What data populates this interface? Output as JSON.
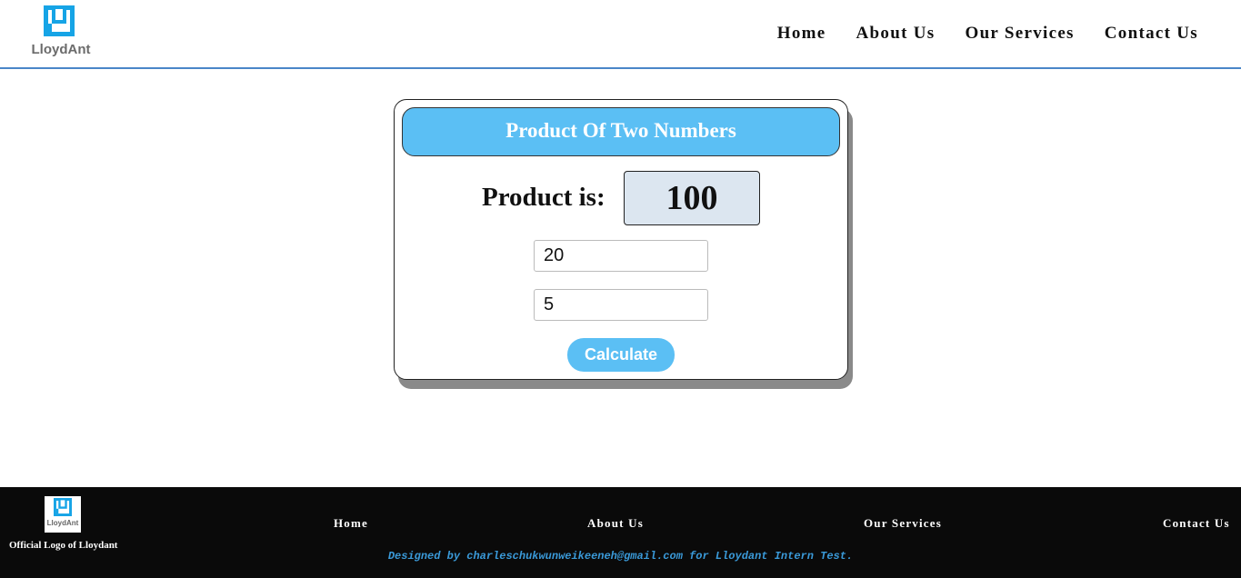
{
  "header": {
    "logo_text": "LloydAnt",
    "nav": [
      {
        "label": "Home"
      },
      {
        "label": "About Us"
      },
      {
        "label": "Our Services"
      },
      {
        "label": "Contact Us"
      }
    ]
  },
  "card": {
    "title": "Product Of Two Numbers",
    "product_label": "Product is:",
    "product_value": "100",
    "input_a": "20",
    "input_b": "5",
    "button_label": "Calculate"
  },
  "footer": {
    "logo_text": "LloydAnt",
    "logo_caption": "Official Logo of Lloydant",
    "links": [
      {
        "label": "Home"
      },
      {
        "label": "About Us"
      },
      {
        "label": "Our Services"
      },
      {
        "label": "Contact Us"
      }
    ],
    "credit": "Designed by charleschukwunweikeeneh@gmail.com for Lloydant Intern Test."
  },
  "colors": {
    "accent": "#5bbff4",
    "header_border": "#4a86c8",
    "footer_bg": "#0a0a0a",
    "credit_text": "#3a9ad9"
  },
  "icons": {
    "logo": "lloydant-logo-icon"
  }
}
